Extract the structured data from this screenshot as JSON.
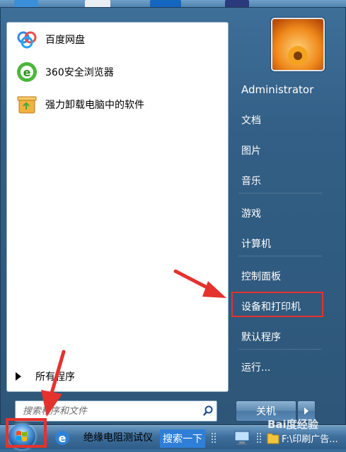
{
  "programs": [
    {
      "label": "百度网盘",
      "icon": "baidu-netdisk-icon"
    },
    {
      "label": "360安全浏览器",
      "icon": "360-browser-icon"
    },
    {
      "label": "强力卸载电脑中的软件",
      "icon": "uninstall-box-icon"
    }
  ],
  "all_programs": "所有程序",
  "search": {
    "placeholder": "搜索程序和文件"
  },
  "right_menu": {
    "user": "Administrator",
    "documents": "文档",
    "pictures": "图片",
    "music": "音乐",
    "games": "游戏",
    "computer": "计算机",
    "control_panel": "控制面板",
    "devices_printers": "设备和打印机",
    "default_programs": "默认程序",
    "run": "运行..."
  },
  "shutdown": {
    "label": "关机"
  },
  "taskbar": {
    "app1": "绝缘电阻测试仪",
    "search_btn": "搜索一下",
    "path": "F:\\印刷广告..."
  },
  "watermark": "Bai度经验",
  "colors": {
    "highlight": "#e5322d",
    "search_blue": "#2f7fd8"
  }
}
